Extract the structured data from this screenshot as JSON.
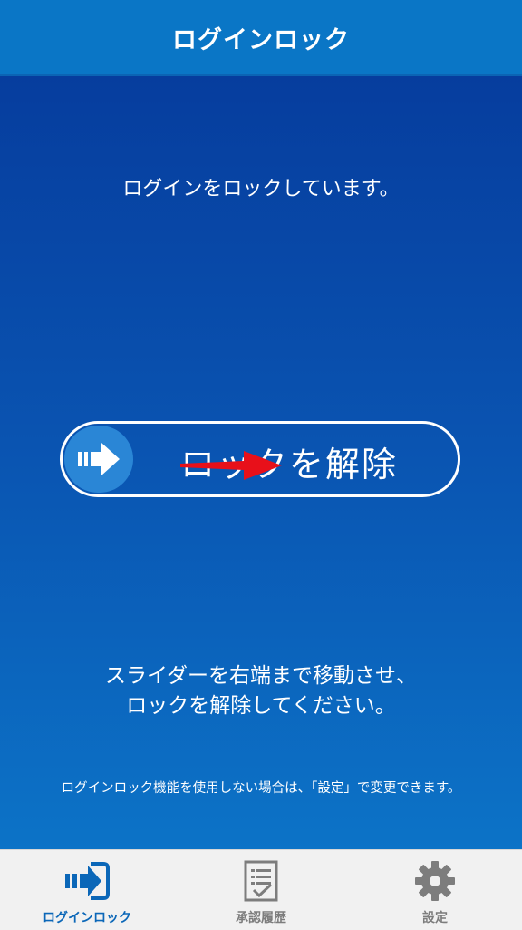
{
  "header": {
    "title": "ログインロック"
  },
  "main": {
    "status_message": "ログインをロックしています。",
    "slider": {
      "label": "ロックを解除",
      "knob_icon": "arrow-right-icon"
    },
    "instructions": {
      "line1": "スライダーを右端まで移動させ、",
      "line2": "ロックを解除してください。"
    },
    "footnote": "ログインロック機能を使用しない場合は、「設定」で変更できます。"
  },
  "tabbar": {
    "tabs": [
      {
        "label": "ログインロック",
        "icon": "login-lock-icon",
        "active": true
      },
      {
        "label": "承認履歴",
        "icon": "document-check-icon",
        "active": false
      },
      {
        "label": "設定",
        "icon": "gear-icon",
        "active": false
      }
    ]
  },
  "colors": {
    "header_bg": "#0a76c6",
    "main_gradient_top": "#063d9e",
    "main_gradient_bottom": "#0c73c7",
    "active_tab": "#0b67b8",
    "inactive_tab": "#7d7d7d",
    "annotation_arrow": "#e8101a"
  }
}
